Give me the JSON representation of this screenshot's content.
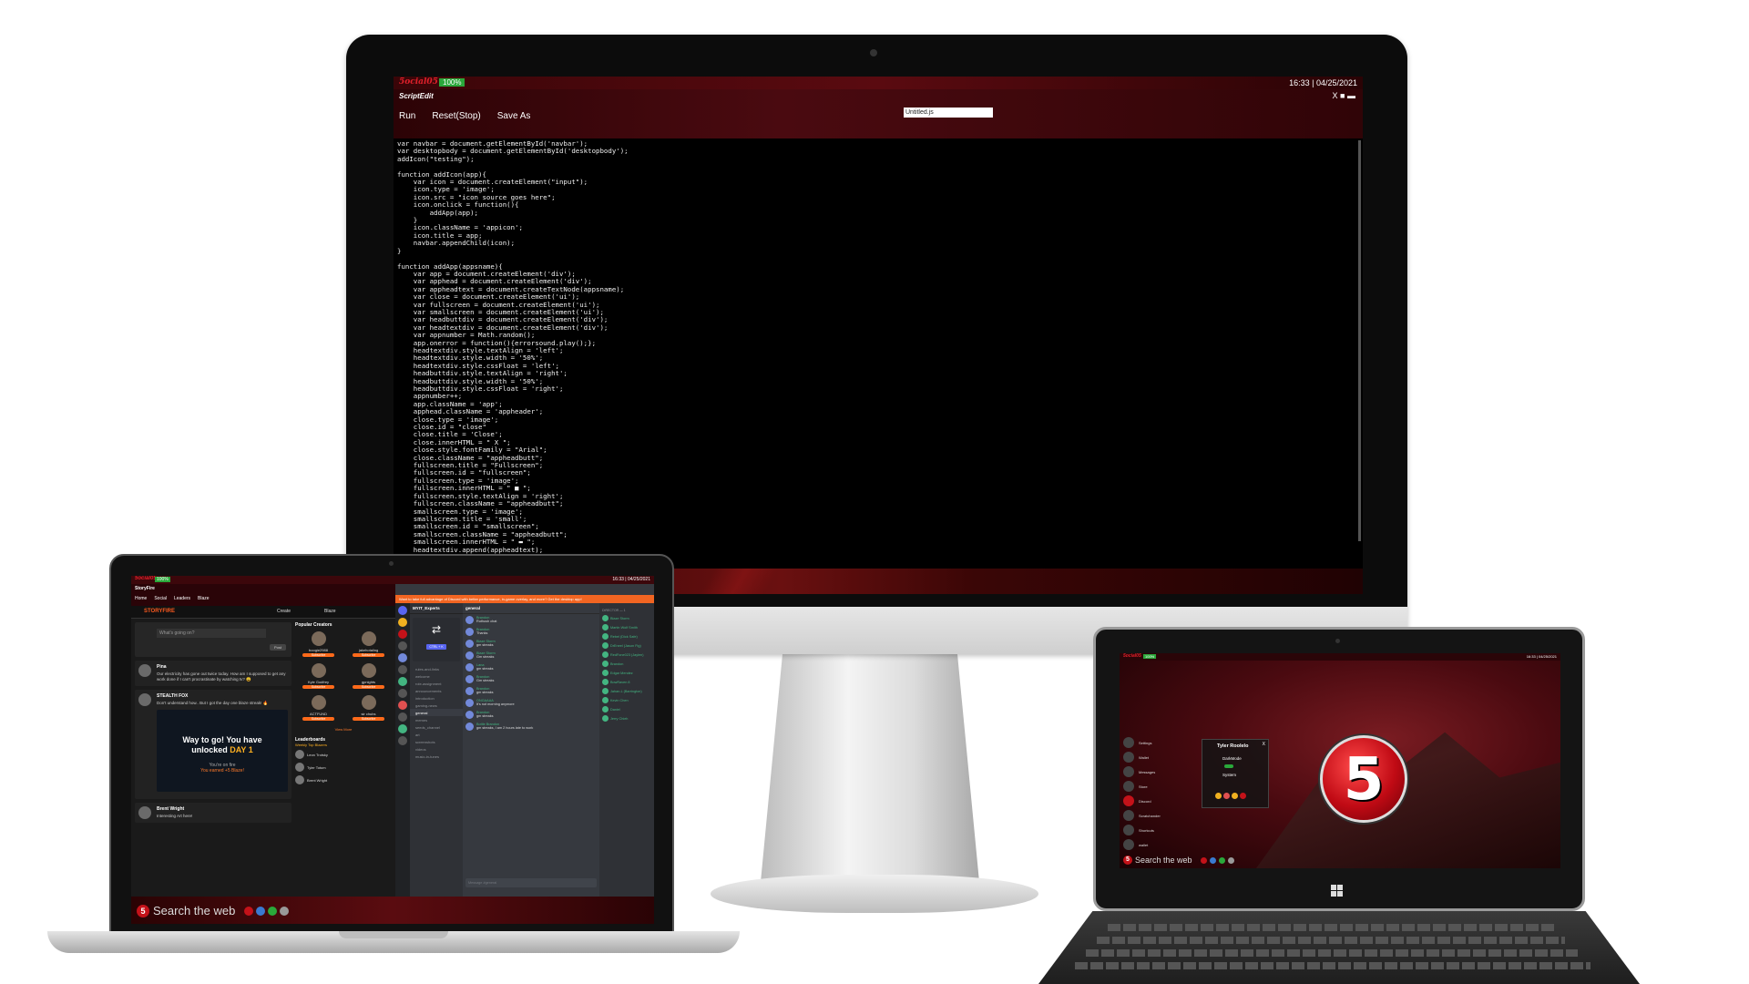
{
  "colors": {
    "accent_red": "#c41219",
    "battery_green": "#2aa83a",
    "storyfire_orange": "#ff5a1f",
    "discord_blurple": "#5865f2"
  },
  "desktop": {
    "logo": "5ocial05",
    "battery": "100%",
    "clock": "16:33 | 04/25/2021",
    "app": {
      "title": "ScriptEdit",
      "window_controls": "X ■ ▬",
      "menu": {
        "run": "Run",
        "reset": "Reset(Stop)",
        "save_as": "Save As"
      },
      "filename": "Untitled.js",
      "code": "var navbar = document.getElementById('navbar');\nvar desktopbody = document.getElementById('desktopbody');\naddIcon(\"testing\");\n\nfunction addIcon(app){\n    var icon = document.createElement(\"input\");\n    icon.type = 'image';\n    icon.src = \"icon source goes here\";\n    icon.onclick = function(){\n        addApp(app);\n    }\n    icon.className = 'appicon';\n    icon.title = app;\n    navbar.appendChild(icon);\n}\n\nfunction addApp(appsname){\n    var app = document.createElement('div');\n    var apphead = document.createElement('div');\n    var appheadtext = document.createTextNode(appsname);\n    var close = document.createElement('ui');\n    var fullscreen = document.createElement('ui');\n    var smallscreen = document.createElement('ui');\n    var headbuttdiv = document.createElement('div');\n    var headtextdiv = document.createElement('div');\n    var appnumber = Math.random();\n    app.onerror = function(){errorsound.play();};\n    headtextdiv.style.textAlign = 'left';\n    headtextdiv.style.width = '50%';\n    headtextdiv.style.cssFloat = 'left';\n    headbuttdiv.style.textAlign = 'right';\n    headbuttdiv.style.width = '50%';\n    headbuttdiv.style.cssFloat = 'right';\n    appnumber++;\n    app.className = 'app';\n    apphead.className = 'appheader';\n    close.type = 'image';\n    close.id = \"close\"\n    close.title = 'Close';\n    close.innerHTML = \" X \";\n    close.style.fontFamily = \"Arial\";\n    close.className = \"appheadbutt\";\n    fullscreen.title = \"Fullscreen\";\n    fullscreen.id = \"fullscreen\";\n    fullscreen.type = 'image';\n    fullscreen.innerHTML = \" ■ \";\n    fullscreen.style.textAlign = 'right';\n    fullscreen.className = \"appheadbutt\";\n    smallscreen.type = 'image';\n    smallscreen.title = 'small';\n    smallscreen.id = \"smallscreen\";\n    smallscreen.className = \"appheadbutt\";\n    smallscreen.innerHTML = \" ▬ \";\n    headtextdiv.append(appheadtext);\n    apphead.append(headtextdiv);"
    }
  },
  "laptop": {
    "logo": "5ocial05",
    "battery": "100%",
    "clock": "16:33 | 04/25/2021",
    "app_name": "StoryFire",
    "nav": [
      "Home",
      "Social",
      "Leaders",
      "Blaze"
    ],
    "storyfire": {
      "brand": "STORYFIRE",
      "create": "Create",
      "blaze": "Blaze",
      "compose_placeholder": "What's going on?",
      "post_button": "Post",
      "posts": [
        {
          "name": "Pina",
          "text": "Our electricity has gone out twice today. How am I supposed to get any work done if I can't procrastinate by watching tv? 😩"
        },
        {
          "name": "STEALTH FOX",
          "text": "Don't understand how.. But I got the day one blaze streak! 🔥"
        }
      ],
      "banner": {
        "line1": "Way to go! You have",
        "line2": "unlocked",
        "day": "DAY 1",
        "on_fire": "You're on fire",
        "earned": "You earned +5 Blaze!"
      },
      "third_post": {
        "name": "Brent Wright",
        "text": "Interesting Art here!"
      },
      "side_title": "Popular Creators",
      "creators": [
        {
          "name": "boogie2988",
          "action": "Subscribe"
        },
        {
          "name": "jakehotaling",
          "action": "Subscribe"
        },
        {
          "name": "Kyle Godfrey",
          "action": "Subscribe"
        },
        {
          "name": "gpnights",
          "action": "Subscribe"
        },
        {
          "name": "ACTFUND",
          "action": "Subscribe"
        },
        {
          "name": "sir chubs",
          "action": "Subscribe"
        }
      ],
      "view_more": "View More",
      "leaderboards_title": "Leaderboards",
      "leaderboards_sub": "Weekly Top Blazers",
      "leaders": [
        "Leon Trotsky",
        "Tyler Totum",
        "Brent Wright"
      ]
    },
    "discord": {
      "banner": "Want to take full advantage of Discord with better performance, in-game overlay, and more? Get the desktop app!",
      "server": "MYIT_Experts",
      "card_cta": "CTRL + K",
      "channels": [
        "rules-and-links",
        "welcome",
        "role-assignment",
        "announcements",
        "introduction",
        "gaming-news",
        "general",
        "memes",
        "seeds_channel",
        "art",
        "screenshots",
        "videos",
        "music-in-tunes"
      ],
      "active_channel": "general",
      "chat_title": "general",
      "messages": [
        {
          "user": "Brandon",
          "text": "Ruthush chat"
        },
        {
          "user": "Brandon",
          "text": "Thanks"
        },
        {
          "user": "Blaze Storm",
          "text": "gm streaks"
        },
        {
          "user": "Blaze Storm",
          "text": "Gm streaks"
        },
        {
          "user": "Lana",
          "text": "gm streaks"
        },
        {
          "user": "Brandon",
          "text": "Gm streaks"
        },
        {
          "user": "Brandon",
          "text": "gm streaks"
        },
        {
          "user": "ONGAAAA",
          "text": "It's not morning anymore"
        },
        {
          "user": "Brandon",
          "text": "gm streaks"
        },
        {
          "user": "Bottle Brandon",
          "text": "gm streaks, I am 2 hours late to work"
        }
      ],
      "input_placeholder": "Message #general",
      "members_heading": "DIRECTOR — 1",
      "members": [
        "Blaze Storm",
        "Martin Wolf Smith",
        "Rebel (Dick Safe)",
        "DrEneel (Jason Fig)",
        "RedFone023 (Jaylen)",
        "Brandon",
        "Edgar Mendez",
        "BowRaven 8",
        "Jahan-L (Barrington)",
        "Kevin Chen",
        "Daniel",
        "Jerry Chieh"
      ]
    },
    "search": "Search the web"
  },
  "tablet": {
    "logo": "5ocial05",
    "battery": "100%",
    "clock": "16:33 | 04/25/2021",
    "menu_items": [
      "Settings",
      "Wallet",
      "Messages",
      "Store",
      "Discord",
      "Scratchander",
      "Shortcuts",
      "wallet"
    ],
    "panel": {
      "user": "Tyler Roolelo",
      "dark_mode": "DarkMode",
      "system": "System",
      "close": "X"
    },
    "big_logo": "5",
    "search": "Search the web"
  }
}
